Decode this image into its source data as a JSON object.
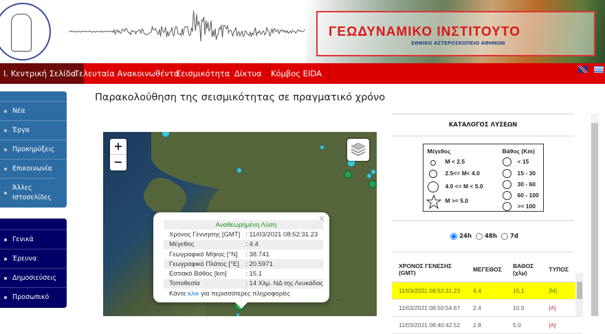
{
  "header": {
    "title": "ΓΕΩΔΥΝΑΜΙΚΟ ΙΝΣΤΙΤΟΥΤΟ",
    "subtitle": "ΕΘΝΙΚΟ ΑΣΤΕΡΟΣΚΟΠΕΙΟ ΑΘΗΝΩΝ",
    "logo_text": "ΕΘΝΙΚΟΝ ΑΣΤΕΡΟΣΚΟΠΕΙΟΝ ΑΘΗΝΩΝ / NATIONAL OBSERVATORY ATHENS"
  },
  "nav": {
    "items": [
      {
        "label": "Ι. Κεντρική Σελίδα",
        "active": true
      },
      {
        "label": "Τελευταία Ανακοινωθέντα"
      },
      {
        "label": "Σεισμικότητα"
      },
      {
        "label": "Δίκτυα"
      },
      {
        "label": "Κόμβος EIDA"
      }
    ],
    "languages": [
      "uk-flag-icon",
      "greek-flag-icon"
    ],
    "color": "#dd0000"
  },
  "sidebar": {
    "group1": [
      "Νέα",
      "Έργα",
      "Προκηρύξεις",
      "Επικοινωνία",
      "Άλλες Ιστοσελίδες"
    ],
    "group2": [
      "Γενικά",
      "Έρευνα",
      "Δημοσιεύσεις",
      "Προσωπικό"
    ],
    "group1_color": "#2e6da4",
    "group2_color": "#000066"
  },
  "main": {
    "title": "Παρακολούθηση της σεισμικότητας σε πραγματικό χρόνο"
  },
  "map": {
    "zoom_in": "+",
    "zoom_out": "−",
    "popup": {
      "header": "Αναθεωρημένη Λύση",
      "rows": [
        [
          "Χρόνος Γέννησης [GMT]",
          ": 11/03/2021 08:52:31.23"
        ],
        [
          "Μέγεθος",
          ": 4.4"
        ],
        [
          "Γεωγραφικό Μήκος [°N]",
          ": 38.741"
        ],
        [
          "Γεωγραφικό Πλάτος [°E]",
          ": 20.5971"
        ],
        [
          "Εστιακό Βάθος [km]",
          ": 15.1"
        ],
        [
          "Τοποθεσία",
          ": 14 Χλμ. ΝΔ της Λευκάδας"
        ]
      ],
      "footer_pre": "Κάντε ",
      "footer_link": "κλικ",
      "footer_post": " για περισσότερες πληροφορίες",
      "close": "×"
    }
  },
  "catalog": {
    "title": "ΚΑΤΑΛΟΓΟΣ ΛΥΣΕΩΝ",
    "legend": {
      "mag_title": "Μέγεθος",
      "mags": [
        "M < 2.5",
        "2.5<= M< 4.0",
        "4.0 <= M < 5.0",
        "M >= 5.0"
      ],
      "depth_title": "Βάθος (Km)",
      "depths": [
        {
          "label": "< 15",
          "color": "#80ffff"
        },
        {
          "label": "15 - 30",
          "color": "#1a9a3a"
        },
        {
          "label": "30 - 60",
          "color": "#ffee00"
        },
        {
          "label": "60 - 100",
          "color": "#ff8020"
        },
        {
          "label": ">= 100",
          "color": "#e01010"
        }
      ]
    },
    "periods": [
      "24h",
      "48h",
      "7d"
    ],
    "selected_period": "24h",
    "columns": [
      "ΧΡΟΝΟΣ ΓΕΝΕΣΗΣ (GMT)",
      "ΜΕΓΕΘΟΣ",
      "ΒΑΘΟΣ (χλμ)",
      "ΤΥΠΟΣ"
    ],
    "rows": [
      [
        "11/03/2021 08:52:31.23",
        "4.4",
        "15.1",
        "[M]"
      ],
      [
        "11/03/2021 08:50:54.67",
        "2.4",
        "10.0",
        "[A]"
      ],
      [
        "11/03/2021 08:40:42.52",
        "2.8",
        "5.0",
        "[A]"
      ]
    ]
  }
}
